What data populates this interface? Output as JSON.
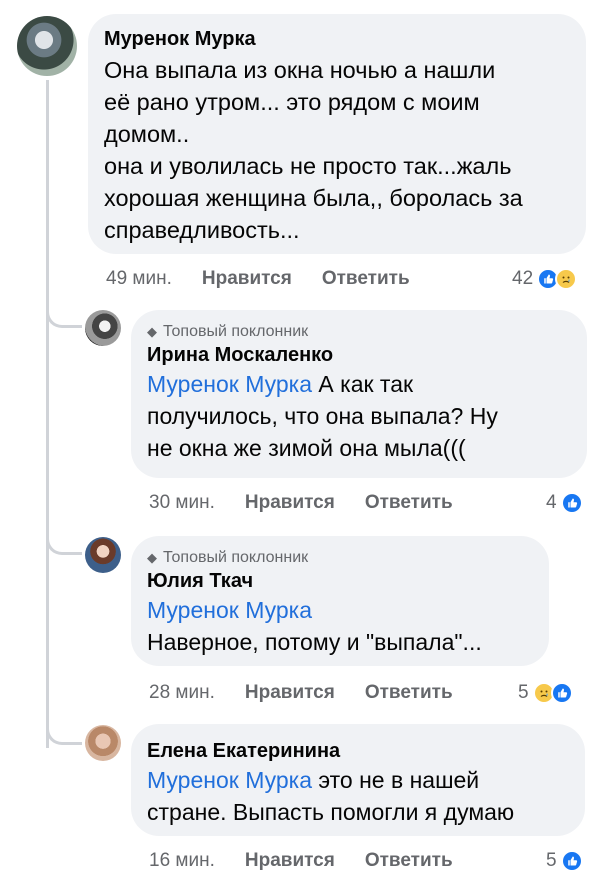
{
  "comment": {
    "author": "Муренок Мурка",
    "text_lines": [
      "Она выпала из окна ночью а нашли",
      "её рано утром... это рядом с моим",
      "домом..",
      "она и уволилась не просто так...жаль",
      "хорошая женщина была,, боролась за",
      "справедливость..."
    ],
    "time": "49 мин.",
    "like_label": "Нравится",
    "reply_label": "Ответить",
    "reaction_count": "42",
    "reactions": [
      "like",
      "sad"
    ]
  },
  "replies": [
    {
      "badge": "Топовый поклонник",
      "author": "Ирина Москаленко",
      "mention": "Муренок Мурка",
      "text_lines": [
        " А как так",
        "получилось, что она выпала? Ну",
        "не окна же зимой она мыла((("
      ],
      "time": "30 мин.",
      "like_label": "Нравится",
      "reply_label": "Ответить",
      "reaction_count": "4",
      "reactions": [
        "like"
      ]
    },
    {
      "badge": "Топовый поклонник",
      "author": "Юлия Ткач",
      "mention": "Муренок Мурка",
      "text_lines": [
        "Наверное,  потому и \"выпала\"..."
      ],
      "time": "28 мин.",
      "like_label": "Нравится",
      "reply_label": "Ответить",
      "reaction_count": "5",
      "reactions": [
        "sad",
        "like"
      ]
    },
    {
      "author": "Елена Екатеринина",
      "mention": "Муренок Мурка",
      "text_lines": [
        " это не в нашей",
        "стране. Выпасть помогли я думаю"
      ],
      "time": "16 мин.",
      "like_label": "Нравится",
      "reply_label": "Ответить",
      "reaction_count": "5",
      "reactions": [
        "like"
      ]
    }
  ],
  "icons": {
    "badge_icon": "gem-icon",
    "like_icon": "thumbs-up-icon",
    "sad_icon": "sad-face-icon"
  },
  "colors": {
    "bubble": "#f0f2f5",
    "mention": "#216fdb",
    "meta": "#65676b",
    "like": "#1877f2",
    "sad": "#f7c94b"
  }
}
